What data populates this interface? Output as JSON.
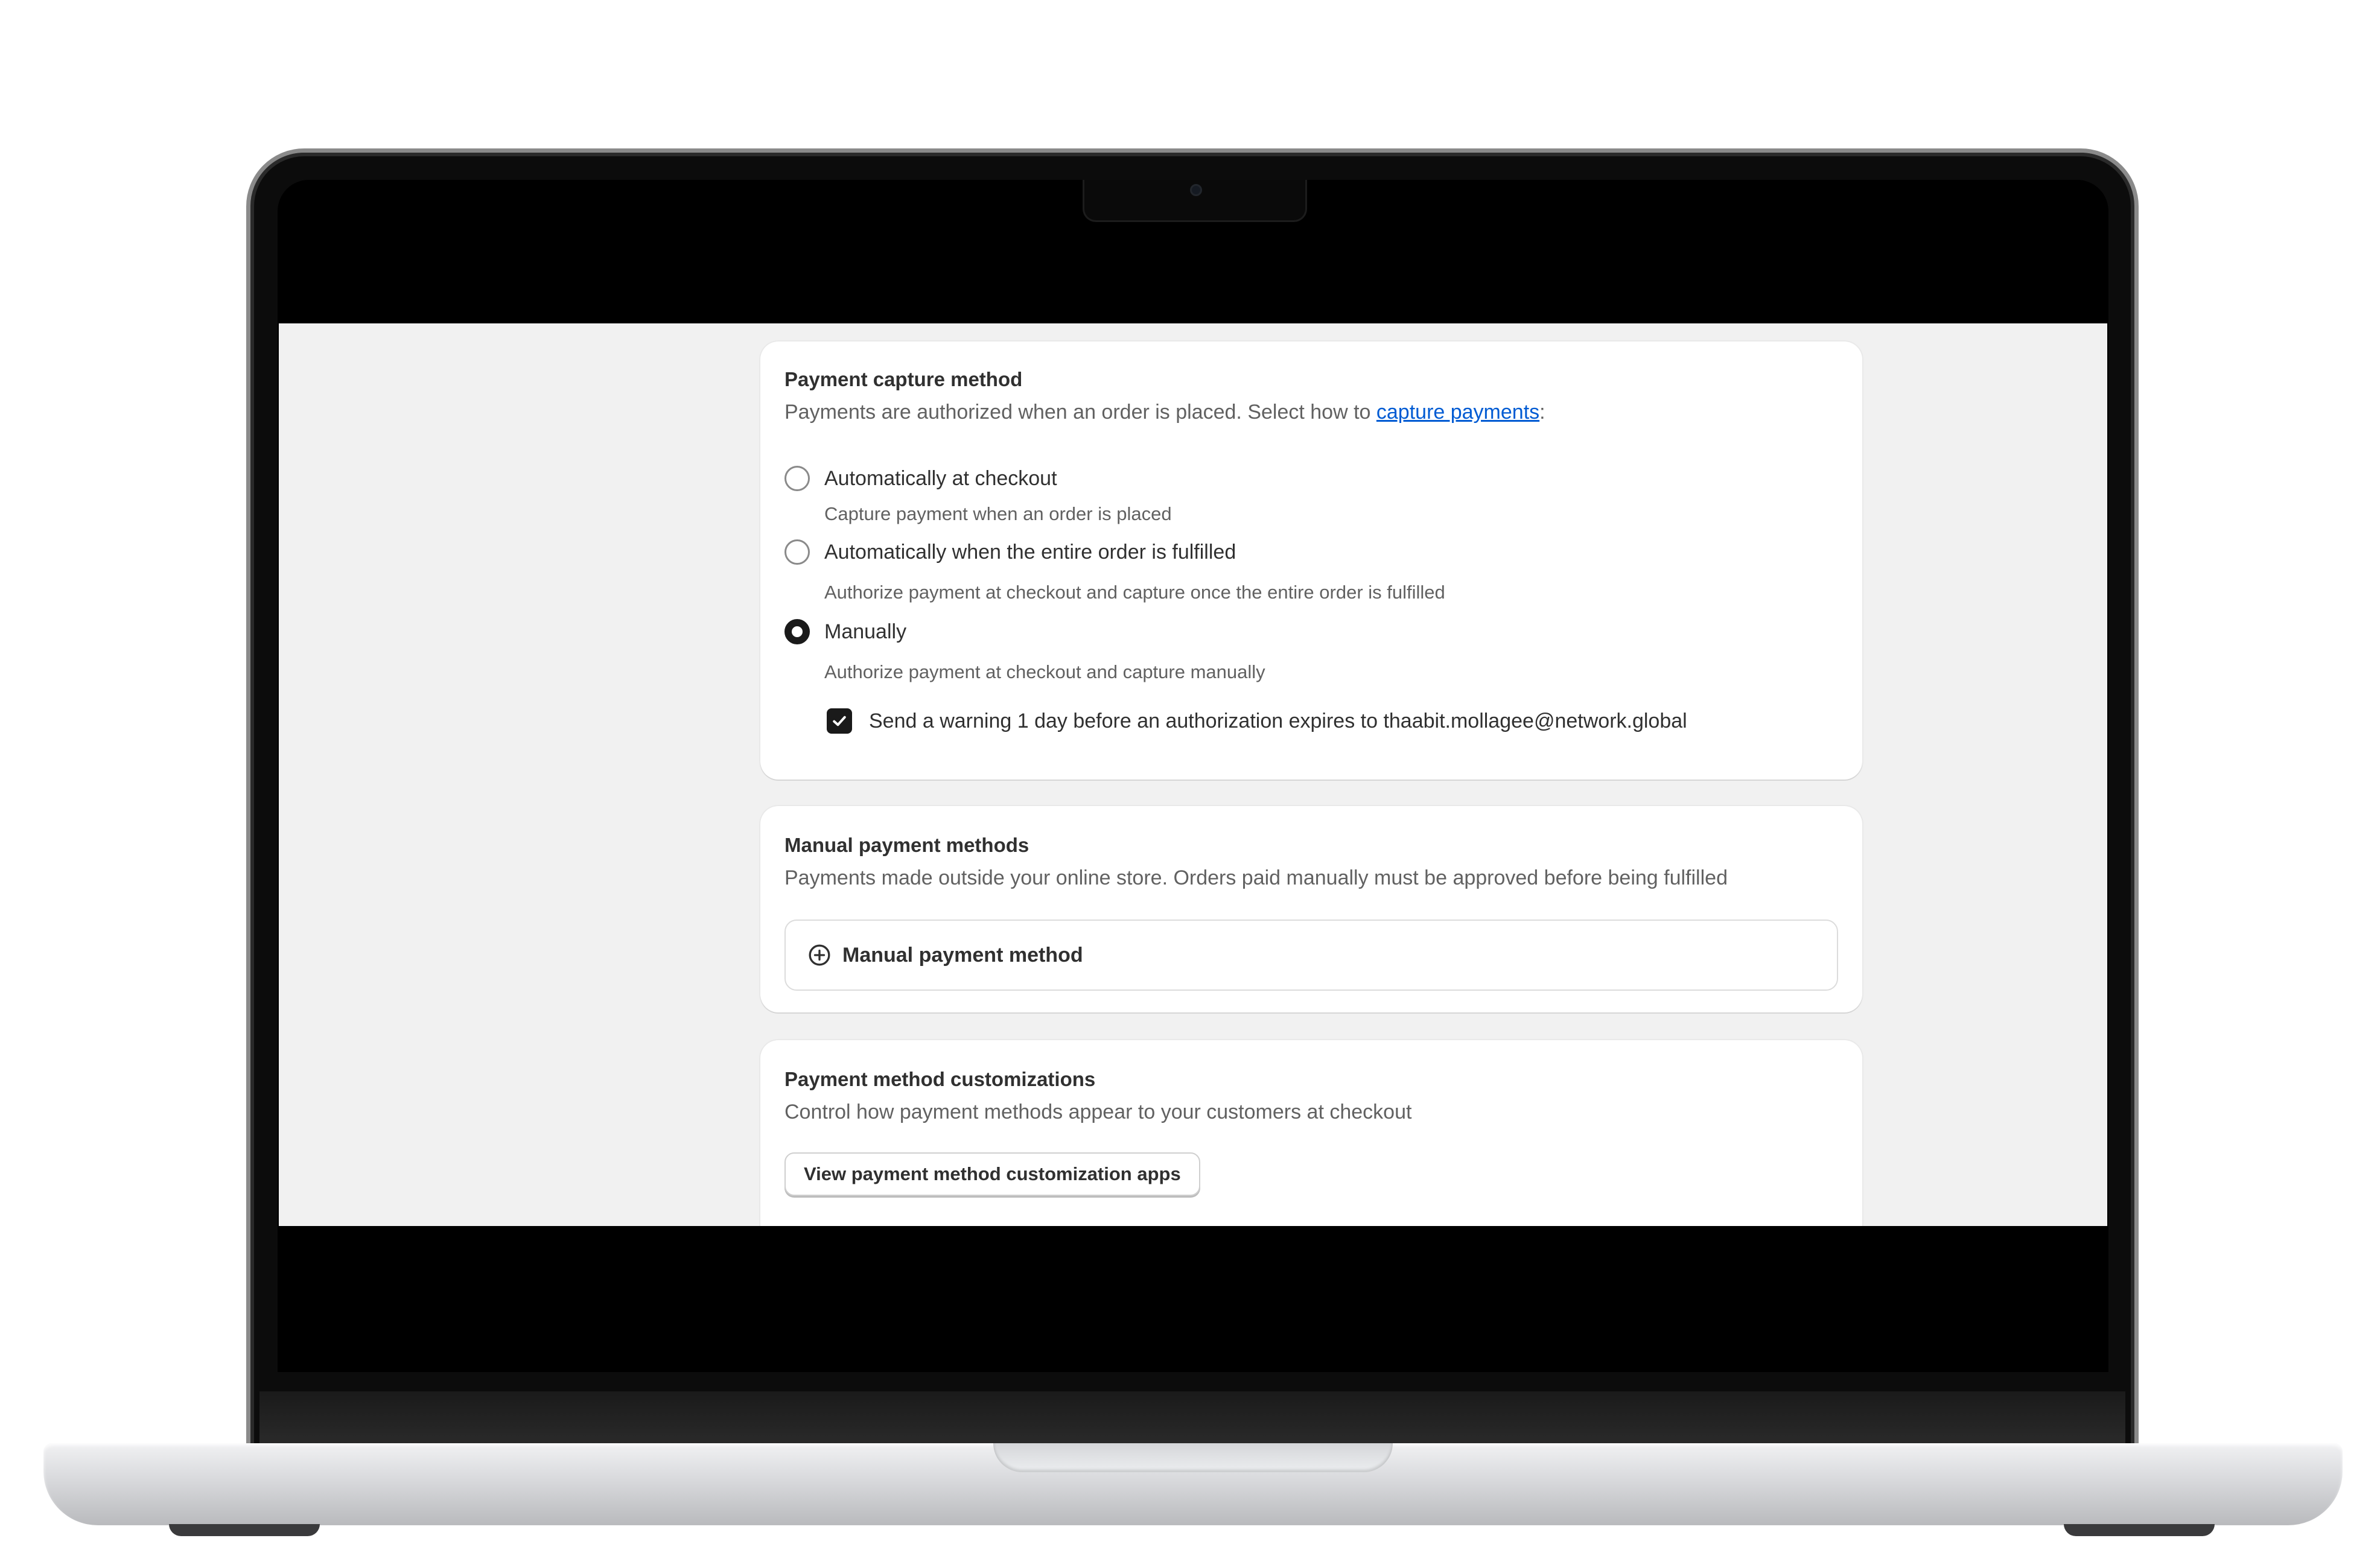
{
  "capture": {
    "title": "Payment capture method",
    "subtitle_prefix": "Payments are authorized when an order is placed. Select how to ",
    "subtitle_link": "capture payments",
    "subtitle_suffix": ":",
    "options": [
      {
        "label": "Automatically at checkout",
        "help": "Capture payment when an order is placed",
        "selected": false
      },
      {
        "label": "Automatically when the entire order is fulfilled",
        "help": "Authorize payment at checkout and capture once the entire order is fulfilled",
        "selected": false
      },
      {
        "label": "Manually",
        "help": "Authorize payment at checkout and capture manually",
        "selected": true
      }
    ],
    "warning": {
      "label": "Send a warning 1 day before an authorization expires to thaabit.mollagee@network.global",
      "checked": true
    }
  },
  "manual": {
    "title": "Manual payment methods",
    "subtitle": "Payments made outside your online store. Orders paid manually must be approved before being fulfilled",
    "add_label": "Manual payment method",
    "add_icon": "plus-circle-icon"
  },
  "customizations": {
    "title": "Payment method customizations",
    "subtitle": "Control how payment methods appear to your customers at checkout",
    "button_label": "View payment method customization apps"
  },
  "colors": {
    "link": "#005bd3",
    "screen_bg": "#f1f1f1",
    "card_bg": "#ffffff",
    "radio_selected": "#1a1a1a"
  }
}
